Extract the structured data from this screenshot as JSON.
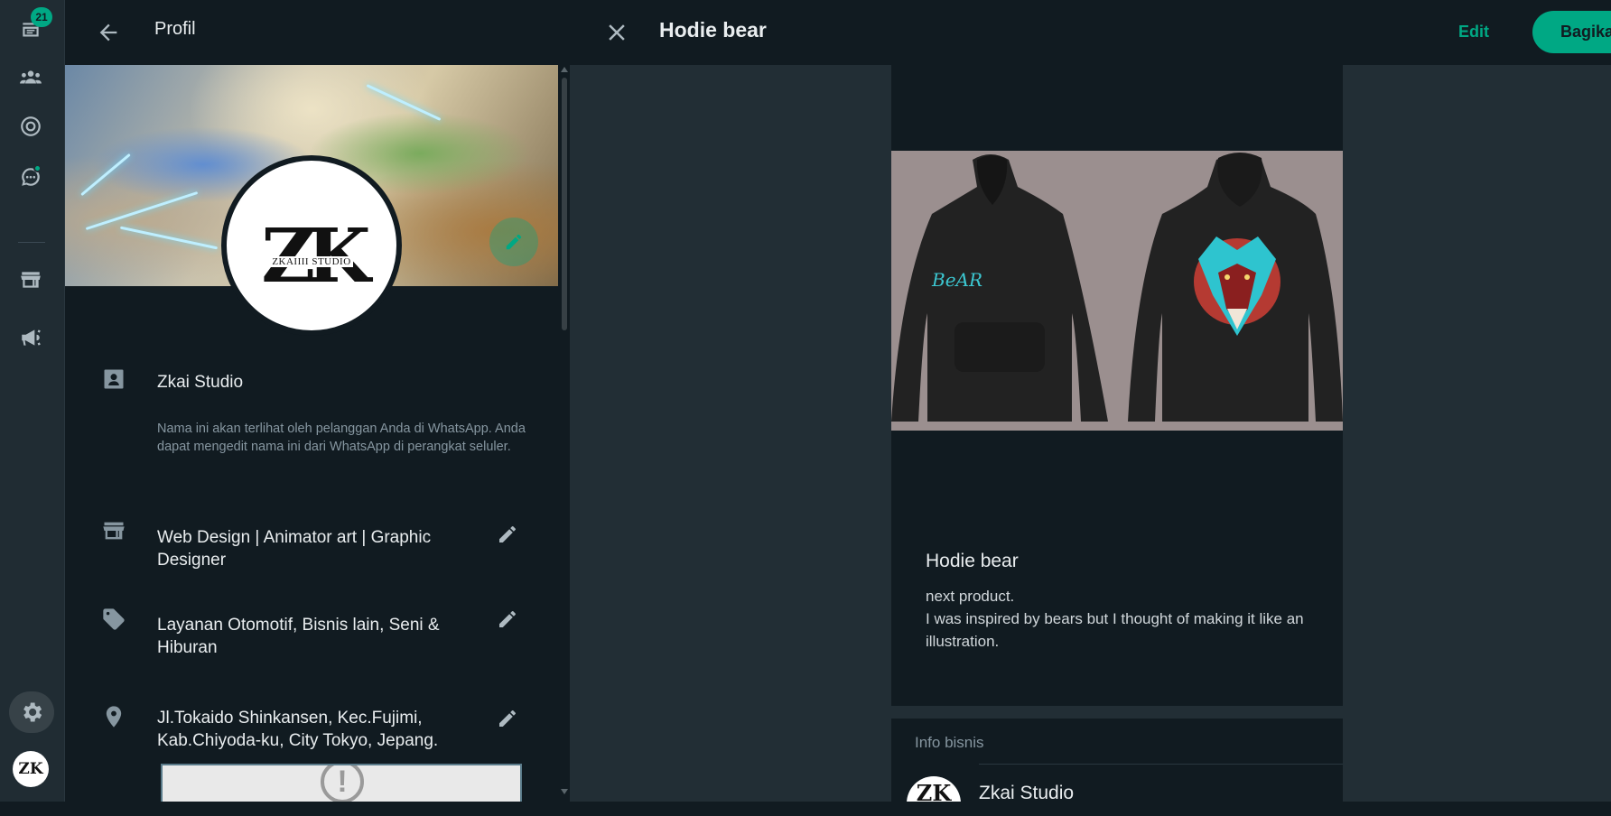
{
  "rail": {
    "chats_badge": "21",
    "icons": [
      "chats-icon",
      "communities-icon",
      "status-icon",
      "channels-icon",
      "catalog-icon",
      "ads-icon",
      "settings-icon"
    ],
    "avatar_text": "ZK"
  },
  "profile": {
    "title": "Profil",
    "logo_mark": "ZK",
    "logo_text": "ZKAIIII STUDIO",
    "name": "Zkai Studio",
    "name_note": "Nama ini akan terlihat oleh pelanggan Anda di WhatsApp. Anda dapat mengedit nama ini dari WhatsApp di perangkat seluler.",
    "description": "Web Design | Animator art | Graphic Designer",
    "categories": "Layanan Otomotif, Bisnis lain, Seni & Hiburan",
    "address": "Jl.Tokaido Shinkansen, Kec.Fujimi, Kab.Chiyoda-ku, City Tokyo, Jepang."
  },
  "main": {
    "title": "Hodie bear",
    "edit_label": "Edit",
    "share_label": "Bagikan",
    "product": {
      "image_text": "BeAR",
      "name": "Hodie bear",
      "desc_line1": "next product.",
      "desc_line2": "I was inspired by bears but I thought of making it like an illustration."
    },
    "business_info": {
      "label": "Info bisnis",
      "name": "Zkai Studio",
      "avatar_text": "ZK"
    }
  },
  "colors": {
    "accent": "#00a884",
    "panel_bg": "#111b21",
    "header_bg": "#202c33",
    "main_bg": "#222e35",
    "hoodie_bg": "#9b8f8f"
  }
}
